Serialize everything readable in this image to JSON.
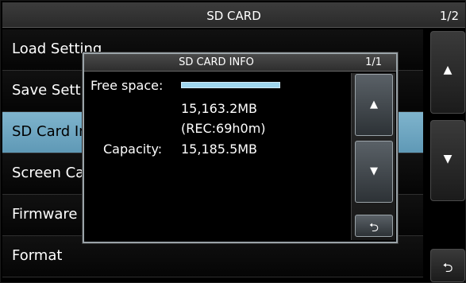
{
  "header": {
    "title": "SD CARD",
    "page": "1/2"
  },
  "menu": {
    "items": [
      {
        "label": "Load Setting"
      },
      {
        "label": "Save Setti"
      },
      {
        "label": "SD Card In"
      },
      {
        "label": "Screen Ca"
      },
      {
        "label": "Firmware"
      },
      {
        "label": "Format"
      }
    ],
    "selected_index": 2
  },
  "side": {
    "up_glyph": "▲",
    "down_glyph": "▼",
    "back_glyph": "⮌"
  },
  "dialog": {
    "title": "SD CARD INFO",
    "page": "1/1",
    "free_space_label": "Free space:",
    "free_space_value": "15,163.2MB",
    "rec_value": "(REC:69h0m)",
    "capacity_label": "Capacity:",
    "capacity_value": "15,185.5MB",
    "free_fraction": 0.9985,
    "up_glyph": "▲",
    "down_glyph": "▼",
    "back_glyph": "⮌"
  },
  "colors": {
    "selected": "#6fa8c3",
    "progress": "#9fd6ee"
  }
}
